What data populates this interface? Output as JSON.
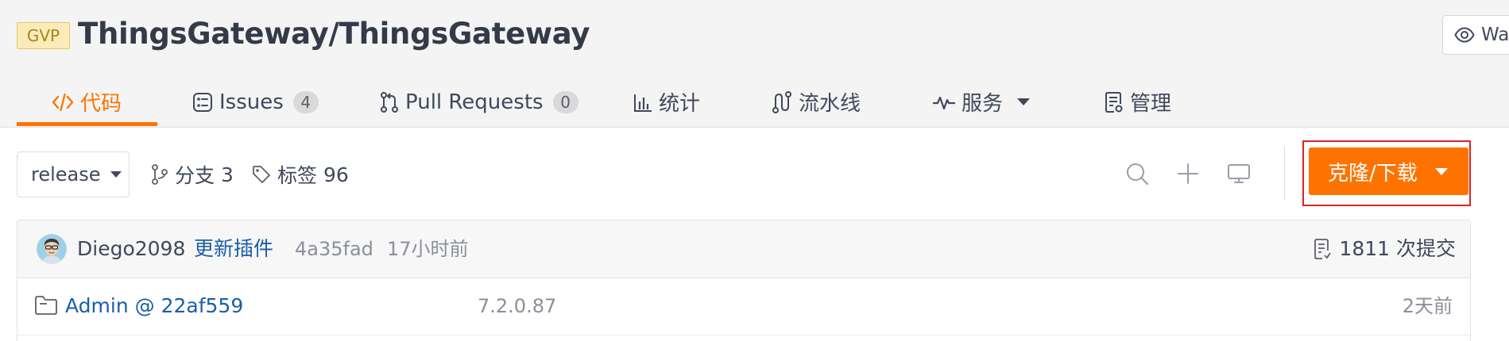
{
  "header": {
    "badge": "GVP",
    "repo_title": "ThingsGateway/ThingsGateway",
    "watch_label": "Wa"
  },
  "tabs": [
    {
      "label": "代码",
      "icon": "code-icon",
      "active": true
    },
    {
      "label": "Issues",
      "count": "4",
      "icon": "issues-icon"
    },
    {
      "label": "Pull Requests",
      "count": "0",
      "icon": "pull-request-icon"
    },
    {
      "label": "统计",
      "icon": "stats-icon"
    },
    {
      "label": "流水线",
      "icon": "pipeline-icon"
    },
    {
      "label": "服务",
      "icon": "service-icon",
      "dropdown": true
    },
    {
      "label": "管理",
      "icon": "manage-icon"
    }
  ],
  "toolbar": {
    "branch": "release",
    "branches_label": "分支",
    "branches_count": "3",
    "tags_label": "标签",
    "tags_count": "96",
    "clone_label": "克隆/下载"
  },
  "latest_commit": {
    "author": "Diego2098",
    "message": "更新插件",
    "sha": "4a35fad",
    "time": "17小时前",
    "commit_count": "1811 次提交"
  },
  "files": [
    {
      "name": "Admin @ 22af559",
      "commit": "7.2.0.87",
      "time": "2天前",
      "icon": "folder-submodule-icon"
    }
  ],
  "colors": {
    "accent": "#fe7300",
    "link": "#1b5ea8",
    "highlight_border": "#e02020"
  }
}
